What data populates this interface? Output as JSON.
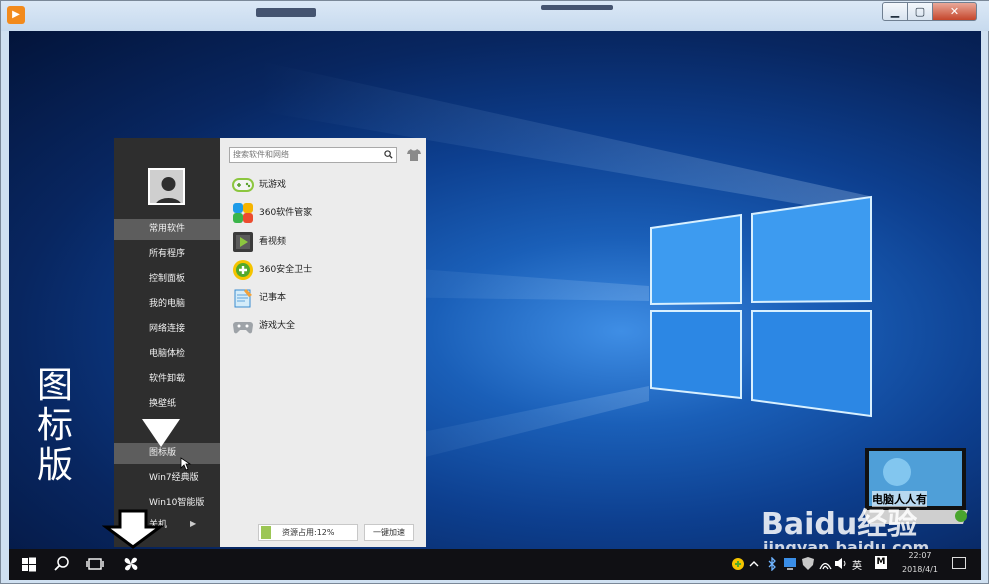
{
  "startmenu": {
    "search_placeholder": "搜索软件和网络",
    "left_items": [
      "常用软件",
      "所有程序",
      "控制面板",
      "我的电脑",
      "网络连接",
      "电脑体检",
      "软件卸载",
      "换壁纸",
      "图标版",
      "Win7经典版",
      "Win10智能版",
      "关机"
    ],
    "active_item": "常用软件",
    "highlighted_item": "图标版",
    "apps": [
      {
        "label": "玩游戏",
        "icon": "gamepad-icon"
      },
      {
        "label": "360软件管家",
        "icon": "software-manager-icon"
      },
      {
        "label": "看视频",
        "icon": "video-play-icon"
      },
      {
        "label": "360安全卫士",
        "icon": "security-guard-icon"
      },
      {
        "label": "记事本",
        "icon": "notepad-icon"
      },
      {
        "label": "游戏大全",
        "icon": "game-controller-icon"
      }
    ],
    "status_label": "资源占用:12%",
    "accelerate_label": "一键加速"
  },
  "annotation": {
    "caption": "图标版"
  },
  "taskbar": {
    "lang": "英",
    "ime": "M",
    "time": "22:07",
    "date": "2018/4/1"
  },
  "watermark": {
    "laptop_text": "电脑人人有",
    "baidu": "Baidu经验",
    "site": "jingyan.baidu.com"
  }
}
